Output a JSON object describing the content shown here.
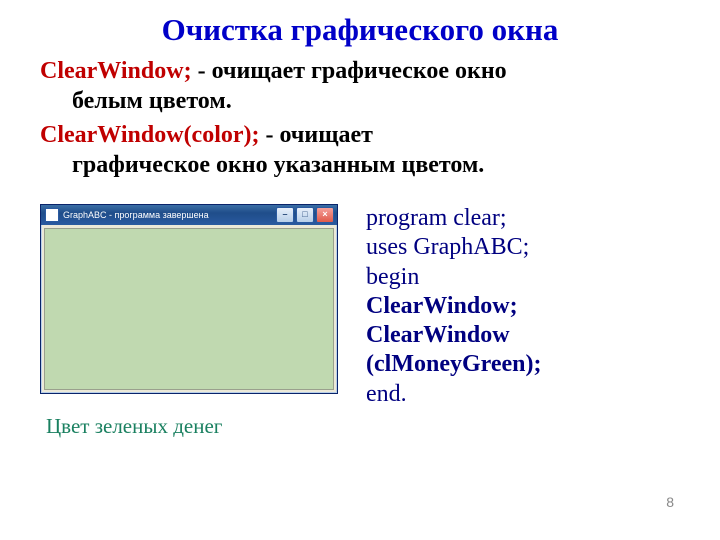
{
  "title": "Очистка графического окна",
  "entries": [
    {
      "cmd": "ClearWindow;",
      "sep": " - ",
      "desc_line1": "очищает графическое окно",
      "desc_line2": "белым цветом."
    },
    {
      "cmd": "ClearWindow(color);",
      "sep": " - ",
      "desc_line1": "очищает",
      "desc_line2": "графическое окно указанным цветом."
    }
  ],
  "window": {
    "title": "GraphABC - программа завершена",
    "min_label": "–",
    "max_label": "□",
    "close_label": "×"
  },
  "caption_under_window": "Цвет зеленых денег",
  "code": {
    "l1": "program clear;",
    "l2": "uses GraphABC;",
    "l3": "begin",
    "l4": "ClearWindow;",
    "l5a": "ClearWindow",
    "l5b": "(clMoneyGreen);",
    "l6": "end."
  },
  "page_number": "8"
}
